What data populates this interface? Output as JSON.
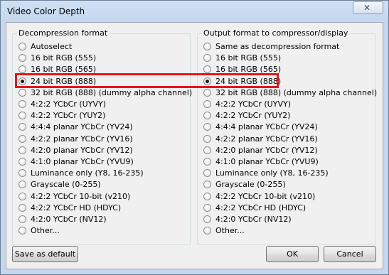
{
  "window": {
    "title": "Video Color Depth"
  },
  "decompression": {
    "legend": "Decompression format",
    "selected": 3,
    "options": [
      "Autoselect",
      "16 bit RGB (555)",
      "16 bit RGB (565)",
      "24 bit RGB (888)",
      "32 bit RGB (888) (dummy alpha channel)",
      "4:2:2 YCbCr (UYVY)",
      "4:2:2 YCbCr (YUY2)",
      "4:4:4 planar YCbCr (YV24)",
      "4:2:2 planar YCbCr (YV16)",
      "4:2:0 planar YCbCr (YV12)",
      "4:1:0 planar YCbCr (YVU9)",
      "Luminance only (Y8, 16-235)",
      "Grayscale (0-255)",
      "4:2:2 YCbCr 10-bit (v210)",
      "4:2:2 YCbCr HD (HDYC)",
      "4:2:0 YCbCr (NV12)",
      "Other..."
    ]
  },
  "output": {
    "legend": "Output format to compressor/display",
    "selected": 3,
    "options": [
      "Same as decompression format",
      "16 bit RGB (555)",
      "16 bit RGB (565)",
      "24 bit RGB (888)",
      "32 bit RGB (888) (dummy alpha channel)",
      "4:2:2 YCbCr (UYVY)",
      "4:2:2 YCbCr (YUY2)",
      "4:4:4 planar YCbCr (YV24)",
      "4:2:2 planar YCbCr (YV16)",
      "4:2:0 planar YCbCr (YV12)",
      "4:1:0 planar YCbCr (YVU9)",
      "Luminance only (Y8, 16-235)",
      "Grayscale (0-255)",
      "4:2:2 YCbCr 10-bit (v210)",
      "4:2:2 YCbCr HD (HDYC)",
      "4:2:0 YCbCr (NV12)",
      "Other..."
    ]
  },
  "buttons": {
    "save_default": "Save as default",
    "ok": "OK",
    "cancel": "Cancel"
  },
  "icons": {
    "close": "close-icon"
  },
  "colors": {
    "highlight": "#e2151f"
  }
}
